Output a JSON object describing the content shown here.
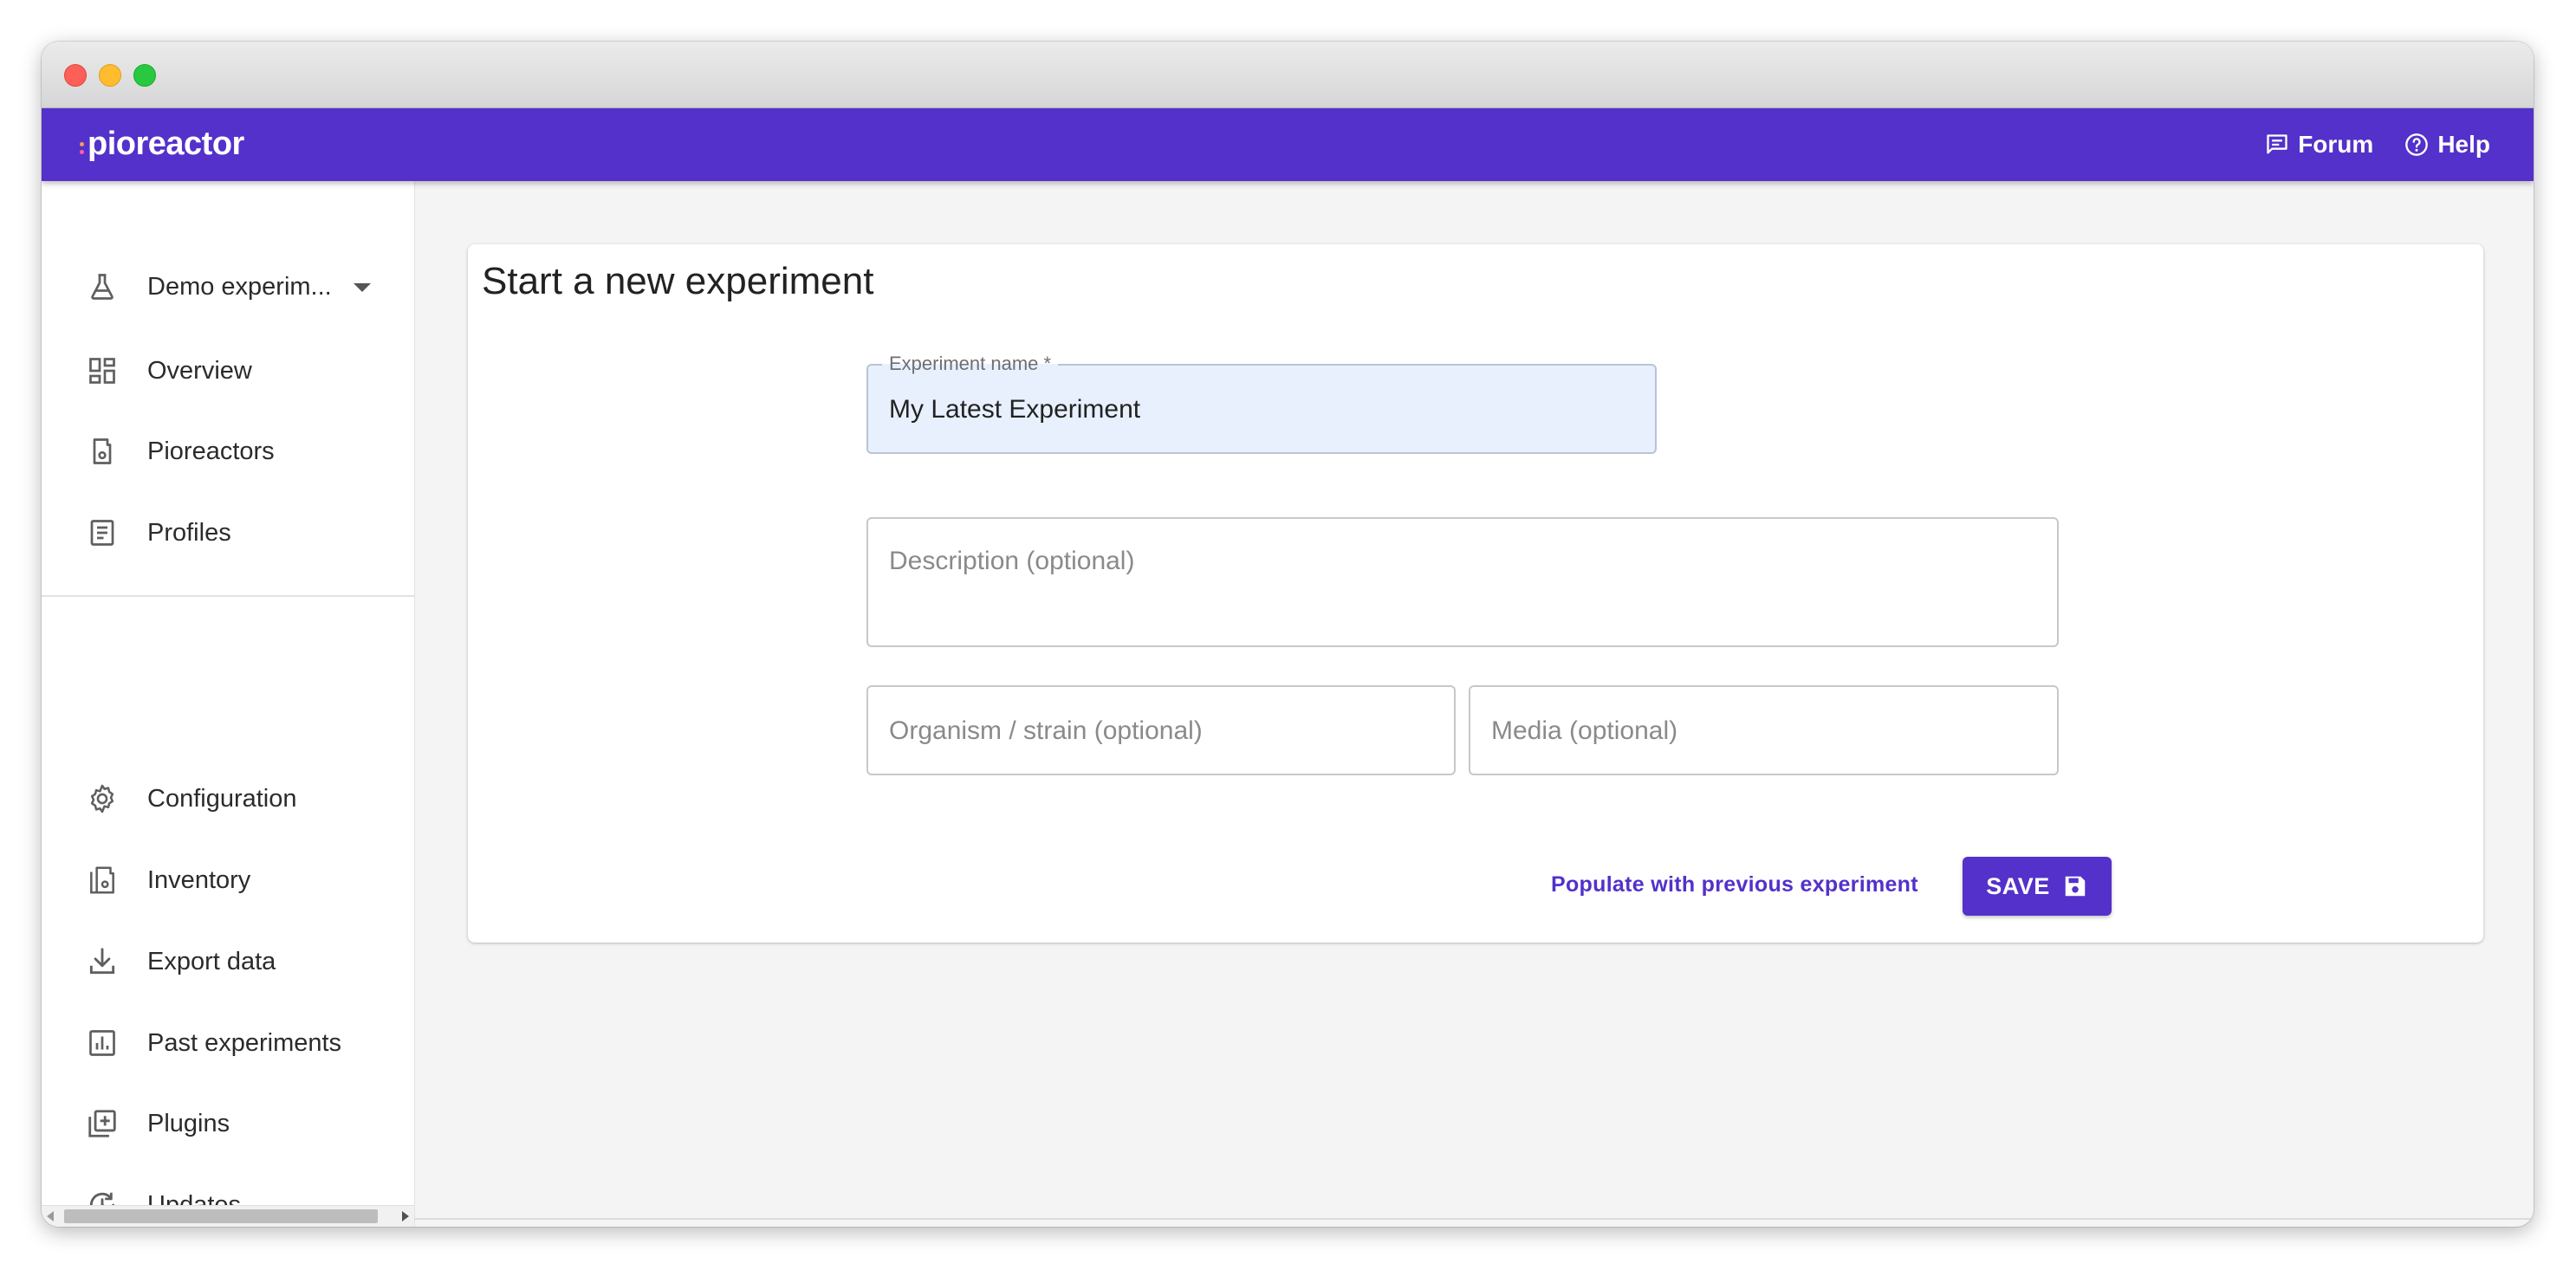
{
  "app": {
    "logo": "pioreactor",
    "brand_color": "#5331ca"
  },
  "topbar": {
    "forum_label": "Forum",
    "help_label": "Help"
  },
  "sidebar": {
    "experiment_selector": "Demo experim...",
    "items_top": [
      {
        "label": "Overview",
        "icon": "dashboard-icon"
      },
      {
        "label": "Pioreactors",
        "icon": "pioreactor-icon"
      },
      {
        "label": "Profiles",
        "icon": "profile-document-icon"
      }
    ],
    "items_bottom": [
      {
        "label": "Configuration",
        "icon": "gear-icon"
      },
      {
        "label": "Inventory",
        "icon": "inventory-icon"
      },
      {
        "label": "Export data",
        "icon": "download-icon"
      },
      {
        "label": "Past experiments",
        "icon": "chart-icon"
      },
      {
        "label": "Plugins",
        "icon": "add-library-icon"
      },
      {
        "label": "Updates",
        "icon": "update-icon"
      }
    ]
  },
  "form": {
    "title": "Start a new experiment",
    "experiment_name_label": "Experiment name *",
    "experiment_name_value": "My Latest Experiment",
    "description_placeholder": "Description (optional)",
    "organism_placeholder": "Organism / strain (optional)",
    "media_placeholder": "Media (optional)",
    "populate_label": "Populate with previous experiment",
    "save_label": "SAVE"
  }
}
